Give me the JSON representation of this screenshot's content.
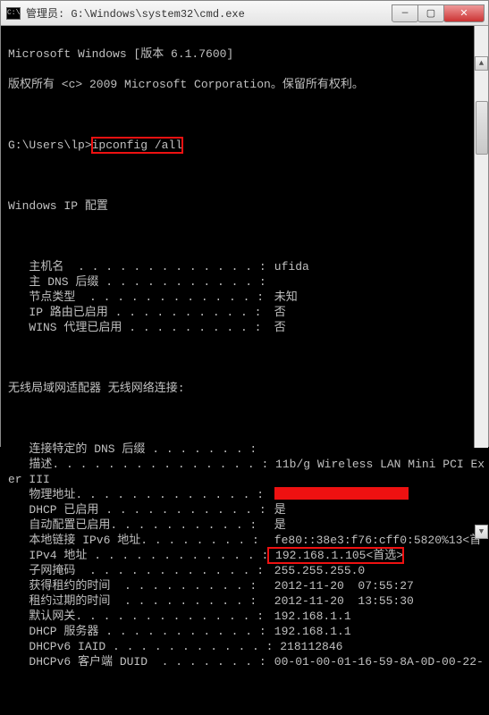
{
  "window": {
    "title": "管理员: G:\\Windows\\system32\\cmd.exe",
    "icon_label": "C:\\"
  },
  "header": {
    "line1": "Microsoft Windows [版本 6.1.7600]",
    "line2": "版权所有 <c> 2009 Microsoft Corporation。保留所有权利。"
  },
  "prompt": {
    "path": "G:\\Users\\lp>",
    "command": "ipconfig /all"
  },
  "section1_title": "Windows IP 配置",
  "section1": [
    {
      "label": "   主机名  . . . . . . . . . . . . . :",
      "value": " ufida"
    },
    {
      "label": "   主 DNS 后缀 . . . . . . . . . . . :",
      "value": ""
    },
    {
      "label": "   节点类型  . . . . . . . . . . . . :",
      "value": " 未知"
    },
    {
      "label": "   IP 路由已启用 . . . . . . . . . . :",
      "value": " 否"
    },
    {
      "label": "   WINS 代理已启用 . . . . . . . . . :",
      "value": " 否"
    }
  ],
  "section2_title": "无线局域网适配器 无线网络连接:",
  "section2": [
    {
      "label": "   连接特定的 DNS 后缀 . . . . . . . :",
      "value": ""
    },
    {
      "label": "   描述. . . . . . . . . . . . . . . :",
      "value": " 11b/g Wireless LAN Mini PCI Ex"
    },
    {
      "label": "er III",
      "value": ""
    },
    {
      "label": "   物理地址. . . . . . . . . . . . . :",
      "value": "REDBLOCK"
    },
    {
      "label": "   DHCP 已启用 . . . . . . . . . . . :",
      "value": " 是"
    },
    {
      "label": "   自动配置已启用. . . . . . . . . . :",
      "value": " 是"
    },
    {
      "label": "   本地链接 IPv6 地址. . . . . . . . :",
      "value": " fe80::38e3:f76:cff0:5820%13<首"
    },
    {
      "label": "   IPv4 地址 . . . . . . . . . . . . :",
      "value": " 192.168.1.105<首选>",
      "boxed": true
    },
    {
      "label": "   子网掩码  . . . . . . . . . . . . :",
      "value": " 255.255.255.0"
    },
    {
      "label": "   获得租约的时间  . . . . . . . . . :",
      "value": " 2012-11-20  07:55:27"
    },
    {
      "label": "   租约过期的时间  . . . . . . . . . :",
      "value": " 2012-11-20  13:55:30"
    },
    {
      "label": "   默认网关. . . . . . . . . . . . . :",
      "value": " 192.168.1.1"
    },
    {
      "label": "   DHCP 服务器 . . . . . . . . . . . :",
      "value": " 192.168.1.1"
    },
    {
      "label": "   DHCPv6 IAID . . . . . . . . . . . :",
      "value": " 218112846"
    },
    {
      "label": "   DHCPv6 客户端 DUID  . . . . . . . :",
      "value": " 00-01-00-01-16-59-8A-0D-00-22-"
    }
  ]
}
